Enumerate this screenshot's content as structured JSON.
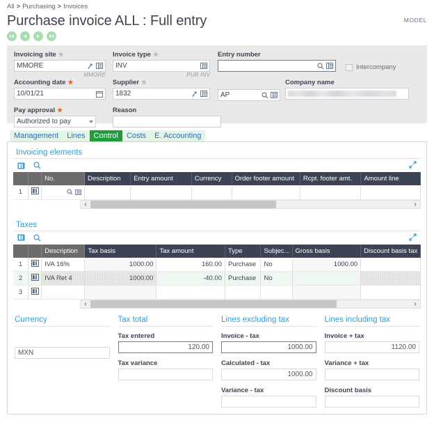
{
  "breadcrumb": {
    "items": [
      "All",
      "Purchasing",
      "Invoices"
    ],
    "separator": ">"
  },
  "header": {
    "title": "Purchase invoice ALL : Full entry",
    "model_tag": "MODEL",
    "nav_buttons": [
      {
        "name": "first-record",
        "icon": "first-icon"
      },
      {
        "name": "previous-record",
        "icon": "previous-icon"
      },
      {
        "name": "next-record",
        "icon": "next-icon"
      },
      {
        "name": "last-record",
        "icon": "last-icon"
      }
    ]
  },
  "form": {
    "invoicing_site": {
      "label": "Invoicing site",
      "value": "MMORE",
      "note": "MMORE",
      "required": true
    },
    "invoice_type": {
      "label": "Invoice type",
      "value": "INV",
      "note": "PUR INV",
      "required": true
    },
    "entry_number": {
      "label": "Entry number",
      "value": "",
      "placeholder": ""
    },
    "intercompany": {
      "label": "Intercompany",
      "checked": false
    },
    "accounting_date": {
      "label": "Accounting date",
      "value": "10/01/21",
      "required": true
    },
    "supplier": {
      "label": "Supplier",
      "value": "1832",
      "required": true
    },
    "supplier_account": {
      "value": "AP"
    },
    "company_name": {
      "label": "Company name",
      "value": "",
      "redacted": true
    },
    "pay_approval": {
      "label": "Pay approval",
      "value": "Authorized to pay",
      "required": true
    },
    "reason": {
      "label": "Reason",
      "value": ""
    }
  },
  "tabs": [
    {
      "label": "Management",
      "active": false
    },
    {
      "label": "Lines",
      "active": false
    },
    {
      "label": "Control",
      "active": true
    },
    {
      "label": "Costs",
      "active": false
    },
    {
      "label": "E. Accounting",
      "active": false
    }
  ],
  "invoicing_elements": {
    "title": "Invoicing elements",
    "columns": [
      "",
      "",
      "No.",
      "Description",
      "Entry amount",
      "Currency",
      "Order footer amount",
      "Rcpt. footer amt.",
      "Amount line"
    ],
    "rows": [
      {
        "index": "1",
        "no": "",
        "description": "",
        "entry_amount": "",
        "currency": "",
        "order_footer_amount": "",
        "rcpt_footer_amt": "",
        "amount_line": ""
      }
    ],
    "scroll": {
      "left_arrow": "‹",
      "right_arrow": "›"
    }
  },
  "taxes": {
    "title": "Taxes",
    "columns": [
      "",
      "",
      "Description",
      "Tax basis",
      "Tax amount",
      "Type",
      "Subjec...",
      "Gross basis",
      "Discount basis tax"
    ],
    "rows": [
      {
        "index": "1",
        "description": "IVA 16%",
        "tax_basis": "1000.00",
        "tax_amount": "160.00",
        "type": "Purchase",
        "subject": "No",
        "gross_basis": "1000.00",
        "discount_basis_tax": ""
      },
      {
        "index": "2",
        "description": "IVA Ret 4",
        "tax_basis": "1000.00",
        "tax_amount": "-40.00",
        "type": "Purchase",
        "subject": "No",
        "gross_basis": "",
        "discount_basis_tax": ""
      },
      {
        "index": "3",
        "description": "",
        "tax_basis": "",
        "tax_amount": "",
        "type": "",
        "subject": "",
        "gross_basis": "",
        "discount_basis_tax": ""
      }
    ],
    "scroll": {
      "left_arrow": "‹",
      "right_arrow": "›"
    }
  },
  "totals": {
    "currency": {
      "heading": "Currency",
      "value": "MXN"
    },
    "tax_total": {
      "heading": "Tax total",
      "tax_entered_label": "Tax entered",
      "tax_entered_value": "120.00",
      "tax_variance_label": "Tax variance",
      "tax_variance_value": ""
    },
    "lines_excluding_tax": {
      "heading": "Lines excluding tax",
      "invoice_tax_label": "Invoice - tax",
      "invoice_tax_value": "1000.00",
      "calculated_tax_label": "Calculated - tax",
      "calculated_tax_value": "1000.00",
      "variance_tax_label": "Variance - tax",
      "variance_tax_value": ""
    },
    "lines_including_tax": {
      "heading": "Lines including tax",
      "invoice_tax_label": "Invoice + tax",
      "invoice_tax_value": "1120.00",
      "variance_tax_label": "Variance + tax",
      "variance_tax_value": "",
      "discount_basis_label": "Discount basis",
      "discount_basis_value": ""
    }
  },
  "colors": {
    "accent_blue": "#2f9fd8",
    "tab_active_green": "#1f9d3d",
    "tab_bg_green": "#e4f4e7",
    "grid_header_navy": "#3d4354",
    "grid_header_gray": "#6b6b6b",
    "required_star": "#e8621a",
    "nav_circle": "#a9dcb0"
  }
}
